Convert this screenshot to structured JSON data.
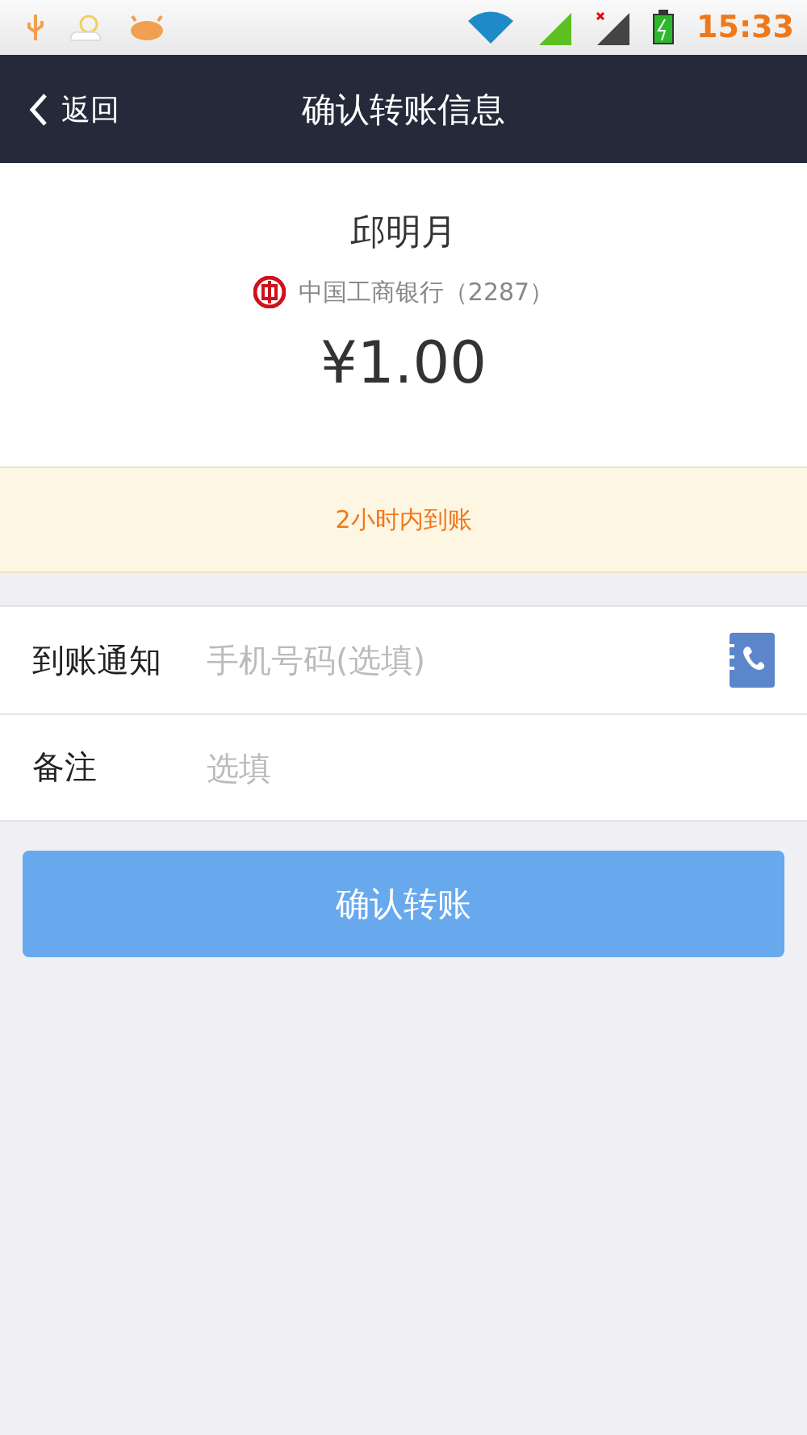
{
  "status_bar": {
    "time": "15:33"
  },
  "nav": {
    "back_label": "返回",
    "title": "确认转账信息"
  },
  "recipient": {
    "name": "邱明月",
    "bank": "中国工商银行（2287）",
    "amount": "¥1.00"
  },
  "notice": "2小时内到账",
  "form": [
    {
      "label": "到账通知",
      "placeholder": "手机号码(选填)",
      "kind": "phone"
    },
    {
      "label": "备注",
      "placeholder": "选填",
      "kind": "text"
    }
  ],
  "submit": {
    "label": "确认转账",
    "disabled": true
  }
}
